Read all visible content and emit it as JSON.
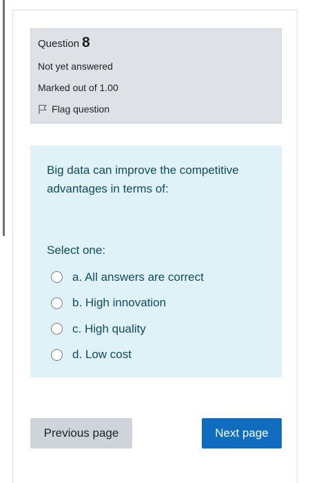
{
  "question": {
    "label": "Question",
    "number": "8",
    "status": "Not yet answered",
    "marks": "Marked out of 1.00",
    "flag_label": "Flag question",
    "text": "Big data can improve the competitive advantages in terms of:",
    "prompt": "Select one:",
    "options": [
      {
        "label": "a. All answers are correct"
      },
      {
        "label": "b. High innovation"
      },
      {
        "label": "c. High quality"
      },
      {
        "label": "d. Low cost"
      }
    ]
  },
  "nav": {
    "previous_label": "Previous page",
    "next_label": "Next page"
  },
  "colors": {
    "info_bg": "#dee2e6",
    "content_bg": "#def2f8",
    "text_accent": "#0f4b5e",
    "primary_button": "#0f6cbf",
    "secondary_button": "#ced4da"
  },
  "icons": {
    "flag": "flag-icon",
    "radio": "radio-unchecked-icon"
  }
}
